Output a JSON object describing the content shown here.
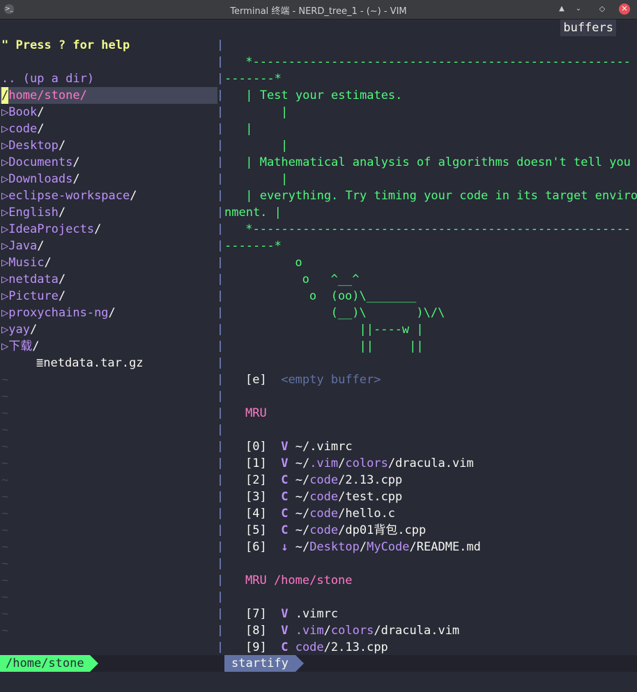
{
  "window": {
    "title": "Terminal 终端 - NERD_tree_1 - (~) - VIM",
    "app_icon": ">_",
    "shade_icon": "▲",
    "minimize_icon": "⌄",
    "maximize_icon": "◇",
    "close_icon": "✕"
  },
  "nerdtree": {
    "help": "\" Press ? for help",
    "updir": ".. (up a dir)",
    "root_prefix": "/",
    "root": "home/stone/",
    "dirs": [
      {
        "name": "Book"
      },
      {
        "name": "code"
      },
      {
        "name": "Desktop"
      },
      {
        "name": "Documents"
      },
      {
        "name": "Downloads"
      },
      {
        "name": "eclipse-workspace"
      },
      {
        "name": "English"
      },
      {
        "name": "IdeaProjects"
      },
      {
        "name": "Java"
      },
      {
        "name": "Music"
      },
      {
        "name": "netdata"
      },
      {
        "name": "Picture"
      },
      {
        "name": "proxychains-ng"
      },
      {
        "name": "yay"
      },
      {
        "name": "下载"
      }
    ],
    "dir_arrow": "▷",
    "dir_slash": "/",
    "file_icon": "≣",
    "file": "netdata.tar.gz",
    "tilde": "~"
  },
  "startify": {
    "buffers_tag": "buffers",
    "box_top_a": " *-----------------------------------------------------",
    "box_top_b": "-------*",
    "quote_1": " | Test your estimates.",
    "quote_1b": "    |",
    "quote_blank": " |",
    "quote_blank_b": "    |",
    "quote_2": " | Mathematical analysis of algorithms doesn't tell you",
    "quote_2b": "    |",
    "quote_3": " | everything. Try timing your code in its target enviro",
    "quote_3b": "nment. |",
    "box_bot_a": " *-----------------------------------------------------",
    "box_bot_b": "-------*",
    "cow": [
      "      o",
      "       o   ^__^",
      "        o  (oo)\\_______",
      "           (__)\\       )\\/\\",
      "               ||----w |",
      "               ||     ||"
    ],
    "empty_index": "[e]",
    "empty_label": "<empty buffer>",
    "mru_title": "MRU",
    "mru": [
      {
        "index": "[0]",
        "icon": "V",
        "pre": "~/",
        "dirs": [],
        "file": ".vimrc",
        "kind": "vim"
      },
      {
        "index": "[1]",
        "icon": "V",
        "pre": "~/",
        "dirs": [
          ".vim",
          "colors"
        ],
        "file": "dracula.vim",
        "kind": "vim"
      },
      {
        "index": "[2]",
        "icon": "C",
        "pre": "~/",
        "dirs": [
          "code"
        ],
        "file": "2.13.cpp",
        "kind": "c"
      },
      {
        "index": "[3]",
        "icon": "C",
        "pre": "~/",
        "dirs": [
          "code"
        ],
        "file": "test.cpp",
        "kind": "c"
      },
      {
        "index": "[4]",
        "icon": "C",
        "pre": "~/",
        "dirs": [
          "code"
        ],
        "file": "hello.c",
        "kind": "c"
      },
      {
        "index": "[5]",
        "icon": "C",
        "pre": "~/",
        "dirs": [
          "code"
        ],
        "file": "dp01背包.cpp",
        "kind": "c"
      },
      {
        "index": "[6]",
        "icon": "↓",
        "pre": "~/",
        "dirs": [
          "Desktop",
          "MyCode"
        ],
        "file": "README.md",
        "kind": "md"
      }
    ],
    "mru_dir_title": "MRU /home/stone",
    "mru_dir": [
      {
        "index": "[7]",
        "icon": "V",
        "pre": "",
        "dirs": [],
        "file": ".vimrc",
        "kind": "vim"
      },
      {
        "index": "[8]",
        "icon": "V",
        "pre": "",
        "dirs": [
          ".vim",
          "colors"
        ],
        "file": "dracula.vim",
        "kind": "vim"
      },
      {
        "index": "[9]",
        "icon": "C",
        "pre": "",
        "dirs": [
          "code"
        ],
        "file": "2.13.cpp",
        "kind": "c"
      }
    ]
  },
  "statusline": {
    "left": "/home/stone",
    "right": "startify"
  },
  "colors": {
    "background": "#282a36",
    "green": "#50fa7b",
    "purple": "#bd93f9",
    "pink": "#ff79c6",
    "yellow": "#f1fa8c",
    "comment": "#6272a4"
  }
}
